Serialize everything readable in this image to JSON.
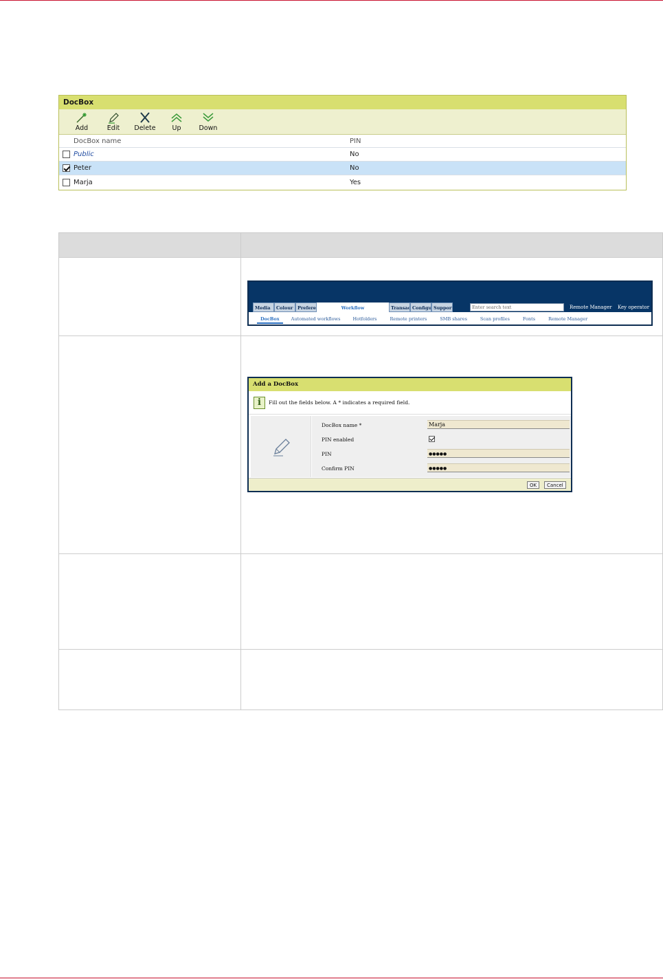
{
  "docbox": {
    "title": "DocBox",
    "toolbar": [
      "Add",
      "Edit",
      "Delete",
      "Up",
      "Down"
    ],
    "columns": [
      "DocBox name",
      "PIN"
    ],
    "rows": [
      {
        "name": "Public",
        "pin": "No",
        "checked": false
      },
      {
        "name": "Peter",
        "pin": "No",
        "checked": true
      },
      {
        "name": "Marja",
        "pin": "Yes",
        "checked": false
      }
    ]
  },
  "nav": {
    "tabs": [
      "Media",
      "Colour",
      "Preferen",
      "Workflow",
      "Transac",
      "Configu",
      "Support"
    ],
    "search_placeholder": "Enter search text",
    "links": [
      "Remote Manager",
      "Key operator"
    ],
    "subtabs": [
      "DocBox",
      "Automated workflows",
      "Hotfolders",
      "Remote printers",
      "SMB shares",
      "Scan profiles",
      "Fonts",
      "Remote Manager"
    ]
  },
  "dialog": {
    "title": "Add a DocBox",
    "info": "Fill out the fields below. A * indicates a required field.",
    "fields": {
      "name_label": "DocBox name *",
      "name_value": "Marja",
      "pin_enabled_label": "PIN enabled",
      "pin_label": "PIN",
      "pin_value": "●●●●●",
      "confirm_label": "Confirm PIN",
      "confirm_value": "●●●●●"
    },
    "ok": "OK",
    "cancel": "Cancel"
  }
}
